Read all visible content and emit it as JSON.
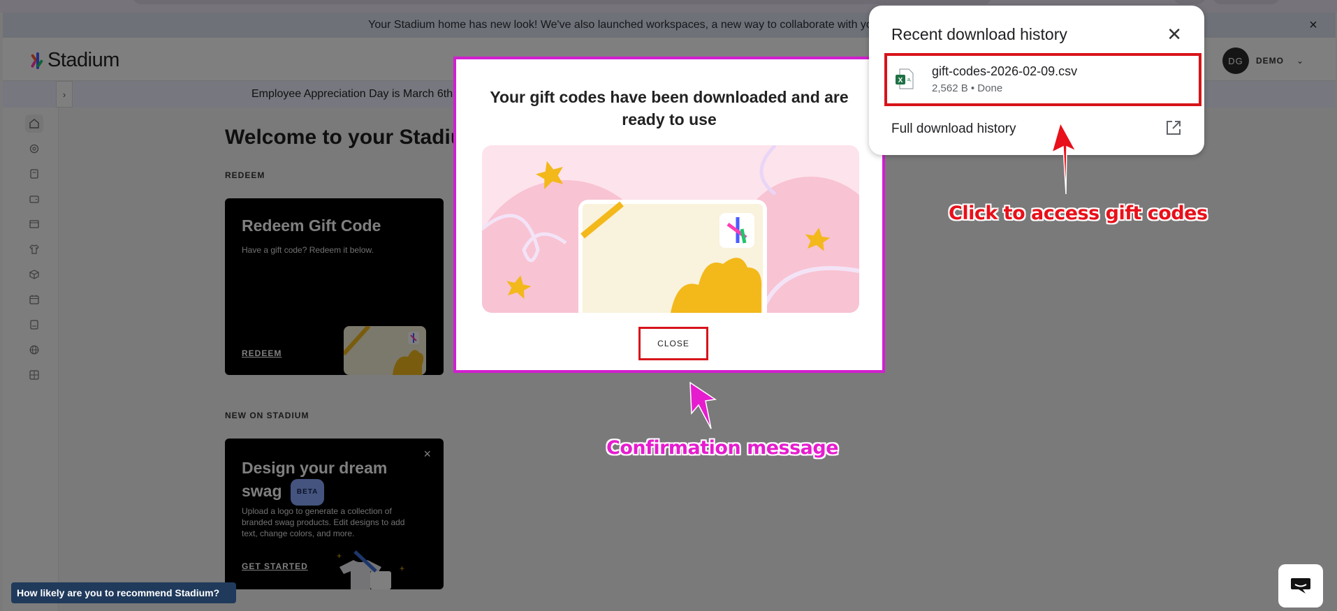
{
  "announcement": {
    "text": "Your Stadium home has new look! We've also launched workspaces, a new way to collaborate with yo",
    "close_icon": "close-icon"
  },
  "header": {
    "logo_text": "Stadium",
    "avatar_initials": "DG",
    "username": "DEMO"
  },
  "subbar": {
    "text": "Employee Appreciation Day is March 6th"
  },
  "sidebar": {
    "icons": [
      "home-icon",
      "gift-icon",
      "clipboard-icon",
      "wallet-icon",
      "store-icon",
      "shirt-icon",
      "box-icon",
      "calendar-icon",
      "book-icon",
      "globe-icon",
      "grid-icon"
    ]
  },
  "main": {
    "welcome": "Welcome to your Stadium",
    "redeem_section": "REDEEM",
    "redeem_card": {
      "title": "Redeem Gift Code",
      "desc": "Have a gift code? Redeem it below.",
      "link": "REDEEM"
    },
    "new_section": "NEW ON STADIUM",
    "swag_card": {
      "title_line1": "Design your dream",
      "title_line2": "swag",
      "badge": "BETA",
      "desc": "Upload a logo to generate a collection of branded swag products. Edit designs to add text, change colors, and more.",
      "link": "GET STARTED"
    }
  },
  "modal": {
    "title": "Your gift codes have been downloaded and are ready to use",
    "close_label": "CLOSE"
  },
  "downloads": {
    "title": "Recent download history",
    "file_name": "gift-codes-2026-02-09.csv",
    "file_meta": "2,562 B • Done",
    "full_history": "Full download history"
  },
  "nps": {
    "text": "How likely are you to recommend Stadium?"
  },
  "annotations": {
    "downloads": "Click to access gift codes",
    "modal": "Confirmation message"
  },
  "colors": {
    "annotation_red": "#e8101a",
    "annotation_pink": "#e61ccf",
    "highlight_red": "#d7141a",
    "modal_border": "#d21fd0",
    "nps_bg": "#203a5c"
  }
}
